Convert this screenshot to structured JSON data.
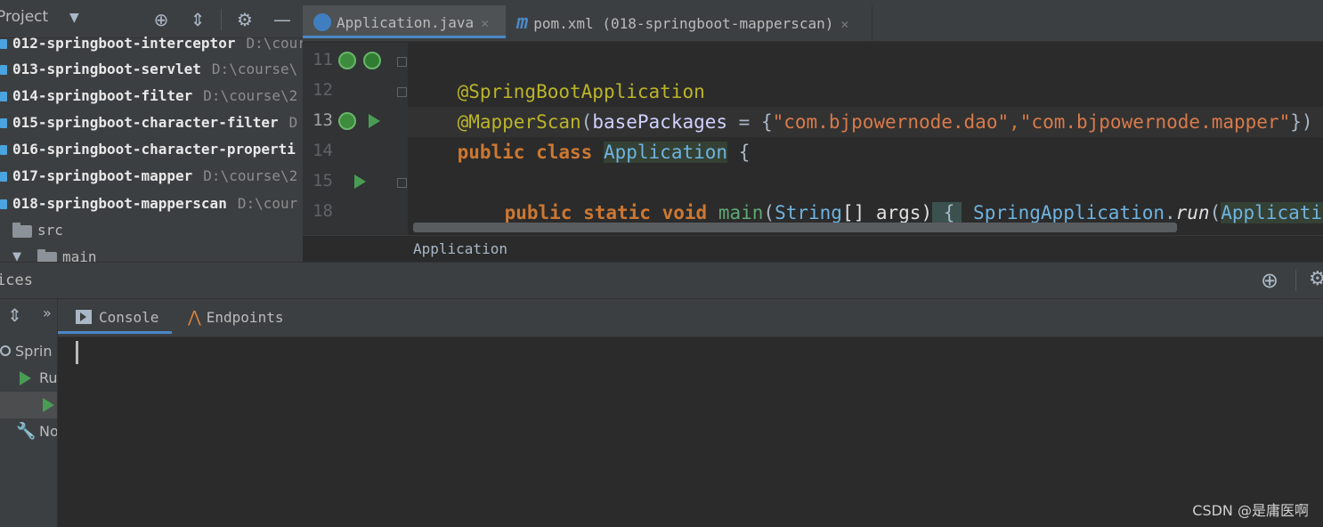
{
  "project_panel": {
    "title": "Project",
    "items": [
      {
        "name": "012-springboot-interceptor",
        "path": "D:\\cour"
      },
      {
        "name": "013-springboot-servlet",
        "path": "D:\\course\\"
      },
      {
        "name": "014-springboot-filter",
        "path": "D:\\course\\2"
      },
      {
        "name": "015-springboot-character-filter",
        "path": "D"
      },
      {
        "name": "016-springboot-character-properti",
        "path": ""
      },
      {
        "name": "017-springboot-mapper",
        "path": "D:\\course\\2"
      },
      {
        "name": "018-springboot-mapperscan",
        "path": "D:\\cour"
      }
    ],
    "src_label": "src",
    "main_label": "main"
  },
  "editor": {
    "tabs": [
      {
        "label": "Application.java",
        "active": true
      },
      {
        "label": "pom.xml (018-springboot-mapperscan)",
        "active": false
      }
    ],
    "line_numbers": [
      "11",
      "12",
      "13",
      "14",
      "15",
      "18"
    ],
    "lines": {
      "l11_annotation": "@SpringBootApplication",
      "l12_annotation": "@MapperScan",
      "l12_open": "(",
      "l12_attr": "basePackages",
      "l12_eq": " = {",
      "l12_str1": "\"com.bjpowernode.dao\"",
      "l12_comma": ",",
      "l12_str2": "\"com.bjpowernode.mapper\"",
      "l12_close": "})",
      "l13_public": "public",
      "l13_class": "class",
      "l13_name": "Application",
      "l13_brace": " {",
      "l15_public": "public",
      "l15_static": "static",
      "l15_void": "void",
      "l15_main": "main",
      "l15_open": "(",
      "l15_type": "String",
      "l15_args": "[] args)",
      "l15_brace": " {",
      "l15_springapp": "SpringApplication",
      "l15_dot": ".",
      "l15_run": "run",
      "l15_open2": "(",
      "l15_applicatio": "Applicatio"
    },
    "breadcrumb": "Application"
  },
  "services": {
    "title": "ices",
    "tabs": [
      {
        "label": "Console",
        "active": true
      },
      {
        "label": "Endpoints",
        "active": false
      }
    ],
    "left_items": [
      "Sprin",
      "Ru",
      "No"
    ],
    "chevron": "»"
  },
  "watermark": "CSDN @是庸医啊",
  "colors": {
    "accent": "#4a88c7",
    "run_green": "#499c54",
    "module_blue": "#4aa4e0",
    "keyword": "#cc7832",
    "annotation": "#bbb529",
    "string": "#6a8759"
  }
}
